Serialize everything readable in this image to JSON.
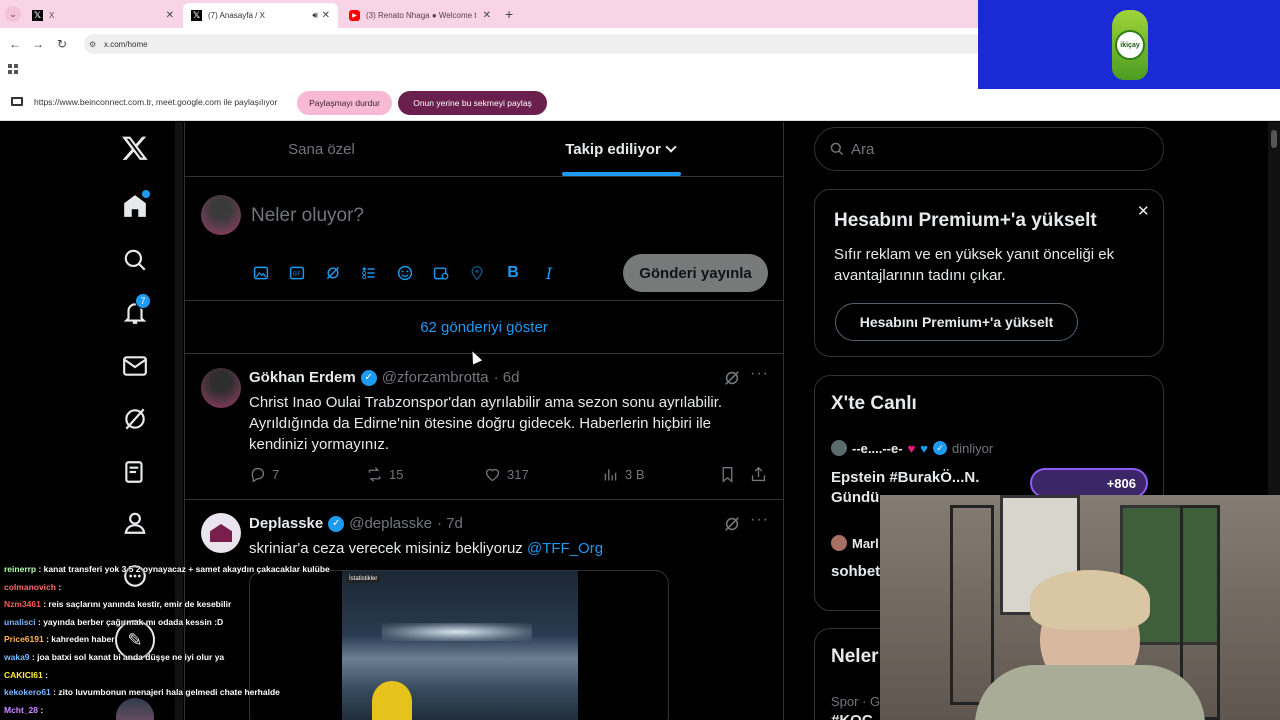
{
  "browser": {
    "tabs": [
      {
        "title": "X"
      },
      {
        "title": "(7) Anasayfa / X"
      },
      {
        "title": "(3) Renato Nhaga ● Welcome t"
      }
    ],
    "url": "x.com/home",
    "share_text": "https://www.beinconnect.com.tr, meet.google.com ile paylaşılıyor",
    "stop_sharing": "Paylaşmayı durdur",
    "share_this_tab": "Onun yerine bu sekmeyi paylaş"
  },
  "ad": {
    "brand": "ikiçay"
  },
  "nav": {
    "notification_count": "7"
  },
  "feed": {
    "tabs": [
      "Sana özel",
      "Takip ediliyor"
    ],
    "active_tab": 1,
    "composer_placeholder": "Neler oluyor?",
    "post_button": "Gönderi yayınla",
    "show_more": "62 gönderiyi göster",
    "posts": [
      {
        "name": "Gökhan Erdem",
        "handle": "@zforzambrotta",
        "time": "· 6d",
        "text": "Christ Inao Oulai Trabzonspor'dan ayrılabilir ama sezon sonu ayrılabilir. Ayrıldığında da Edirne'nin ötesine doğru gidecek. Haberlerin hiçbiri ile kendinizi yormayınız.",
        "replies": "7",
        "reposts": "15",
        "likes": "317",
        "views": "3 B"
      },
      {
        "name": "Deplasske",
        "handle": "@deplasske",
        "time": "· 7d",
        "text": "skriniar'a ceza verecek misiniz bekliyoruz ",
        "mention": "@TFF_Org",
        "media_label": "İstatistikler"
      }
    ]
  },
  "right": {
    "search_placeholder": "Ara",
    "premium": {
      "title": "Hesabını Premium+'a yükselt",
      "body": "Sıfır reklam ve en yüksek yanıt önceliği ek avantajlarının tadını çıkar.",
      "button": "Hesabını Premium+'a yükselt"
    },
    "live": {
      "title": "X'te Canlı",
      "host": "--e....--e-",
      "listening": "dinliyor",
      "topic": "Epstein #BurakÖ...N. Gündü",
      "count": "+806",
      "second_host": "Marl",
      "second_topic": "sohbet"
    },
    "whats_happening": {
      "title": "Neler",
      "sub": "Spor · Gü",
      "tag": "#KOÇ..."
    }
  },
  "chat": [
    {
      "user": "reinerrp",
      "color": "#b0ffb0",
      "msg": "kanat transferi yok 3 5 2 oynayacaz + samet akaydın çakacaklar kulübe"
    },
    {
      "user": "colmanovich",
      "color": "#ff6b6b",
      "msg": ""
    },
    {
      "user": "Nzm3461",
      "color": "#ff5a5a",
      "msg": "reis saçlarını yanında kestir, emir de kesebilir"
    },
    {
      "user": "unalisci",
      "color": "#7ab8ff",
      "msg": "yayında berber çağırmak mı odada kessin :D"
    },
    {
      "user": "Price6191",
      "color": "#ffb74d",
      "msg": "kahreden haber"
    },
    {
      "user": "waka9",
      "color": "#7ab8ff",
      "msg": "joa batxi sol kanat bi anda düşşe ne iyi olur ya"
    },
    {
      "user": "CAKICI61",
      "color": "#ffeb3b",
      "msg": ""
    },
    {
      "user": "kekokero61",
      "color": "#7ab8ff",
      "msg": "zito luvumbonun menajeri hala gelmedi chate herhalde"
    },
    {
      "user": "Mcht_28",
      "color": "#d18cff",
      "msg": ""
    }
  ]
}
